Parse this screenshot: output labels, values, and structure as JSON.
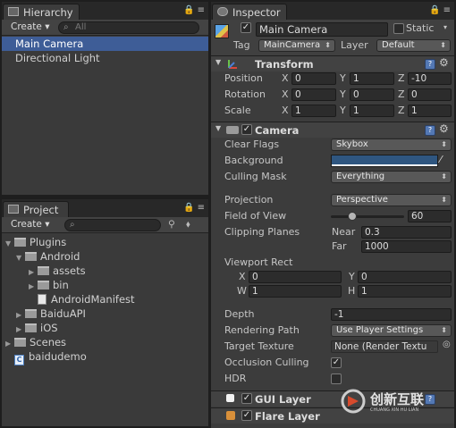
{
  "hierarchy": {
    "tab_label": "Hierarchy",
    "create_label": "Create",
    "search_placeholder": "All",
    "items": [
      "Main Camera",
      "Directional Light"
    ]
  },
  "project": {
    "tab_label": "Project",
    "create_label": "Create",
    "tree": [
      {
        "label": "Plugins",
        "kind": "folder"
      },
      {
        "label": "Android",
        "kind": "folder"
      },
      {
        "label": "assets",
        "kind": "folder"
      },
      {
        "label": "bin",
        "kind": "folder"
      },
      {
        "label": "AndroidManifest",
        "kind": "file"
      },
      {
        "label": "BaiduAPI",
        "kind": "folder"
      },
      {
        "label": "iOS",
        "kind": "folder"
      },
      {
        "label": "Scenes",
        "kind": "folder"
      },
      {
        "label": "baidudemo",
        "kind": "script"
      }
    ]
  },
  "inspector": {
    "tab_label": "Inspector",
    "object_name": "Main Camera",
    "static_label": "Static",
    "tag_label": "Tag",
    "tag_value": "MainCamera",
    "layer_label": "Layer",
    "layer_value": "Default",
    "transform": {
      "title": "Transform",
      "position_label": "Position",
      "rotation_label": "Rotation",
      "scale_label": "Scale",
      "position": {
        "x": "0",
        "y": "1",
        "z": "-10"
      },
      "rotation": {
        "x": "0",
        "y": "0",
        "z": "0"
      },
      "scale": {
        "x": "1",
        "y": "1",
        "z": "1"
      },
      "x_axis": "X",
      "y_axis": "Y",
      "z_axis": "Z"
    },
    "camera": {
      "title": "Camera",
      "clear_flags_label": "Clear Flags",
      "clear_flags_value": "Skybox",
      "background_label": "Background",
      "background_color": "#2f5680",
      "culling_mask_label": "Culling Mask",
      "culling_mask_value": "Everything",
      "projection_label": "Projection",
      "projection_value": "Perspective",
      "fov_label": "Field of View",
      "fov_value": "60",
      "fov_slider_fraction": 0.27,
      "clipping_label": "Clipping Planes",
      "near_label": "Near",
      "near_value": "0.3",
      "far_label": "Far",
      "far_value": "1000",
      "viewport_label": "Viewport Rect",
      "vp_x_label": "X",
      "vp_x": "0",
      "vp_y_label": "Y",
      "vp_y": "0",
      "vp_w_label": "W",
      "vp_w": "1",
      "vp_h_label": "H",
      "vp_h": "1",
      "depth_label": "Depth",
      "depth_value": "-1",
      "rendering_path_label": "Rendering Path",
      "rendering_path_value": "Use Player Settings",
      "target_texture_label": "Target Texture",
      "target_texture_value": "None (Render Textu",
      "occlusion_label": "Occlusion Culling",
      "hdr_label": "HDR"
    },
    "gui_layer": {
      "title": "GUI Layer"
    },
    "flare_layer": {
      "title": "Flare Layer"
    }
  },
  "watermark": {
    "text": "创新互联",
    "subtext": "CHUANG XIN HU LIAN"
  }
}
